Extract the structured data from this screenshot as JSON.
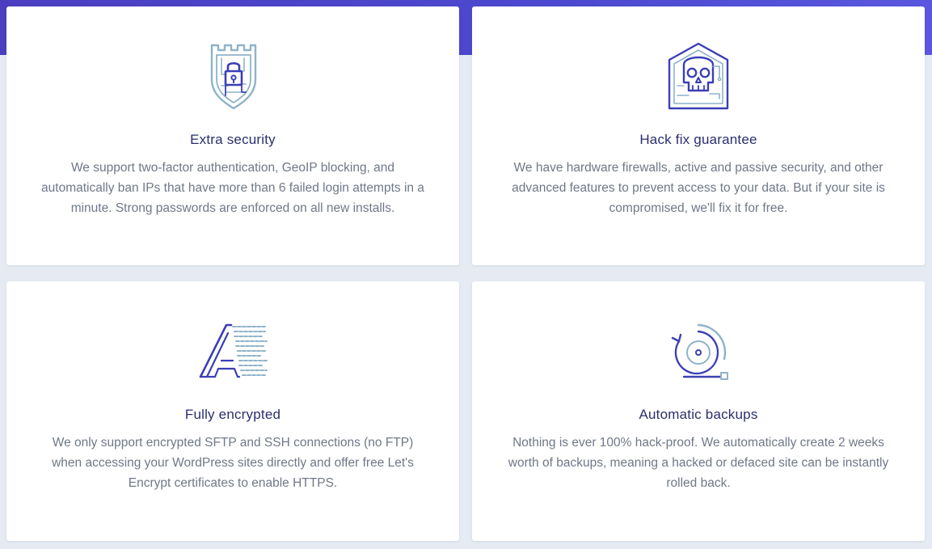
{
  "colors": {
    "accent": "#4b3fc0",
    "icon_primary": "#3b3fb6",
    "icon_secondary": "#8fb3c9",
    "title": "#2a2f6e",
    "text": "#6f7888",
    "background": "#e6ebf3"
  },
  "features": [
    {
      "icon": "shield-lock-icon",
      "title": "Extra security",
      "description": "We support two-factor authentication, GeoIP blocking, and automatically ban IPs that have more than 6 failed login attempts in a minute. Strong passwords are enforced on all new installs."
    },
    {
      "icon": "hacked-skull-icon",
      "title": "Hack fix guarantee",
      "description": "We have hardware firewalls, active and passive security, and other advanced features to prevent access to your data. But if your site is compromised, we'll fix it for free."
    },
    {
      "icon": "encrypted-letter-icon",
      "title": "Fully encrypted",
      "description": "We only support encrypted SFTP and SSH connections (no FTP) when accessing your WordPress sites directly and offer free Let's Encrypt certificates to enable HTTPS."
    },
    {
      "icon": "backup-restore-icon",
      "title": "Automatic backups",
      "description": "Nothing is ever 100% hack-proof. We automatically create 2 weeks worth of backups, meaning a hacked or defaced site can be instantly rolled back."
    }
  ]
}
